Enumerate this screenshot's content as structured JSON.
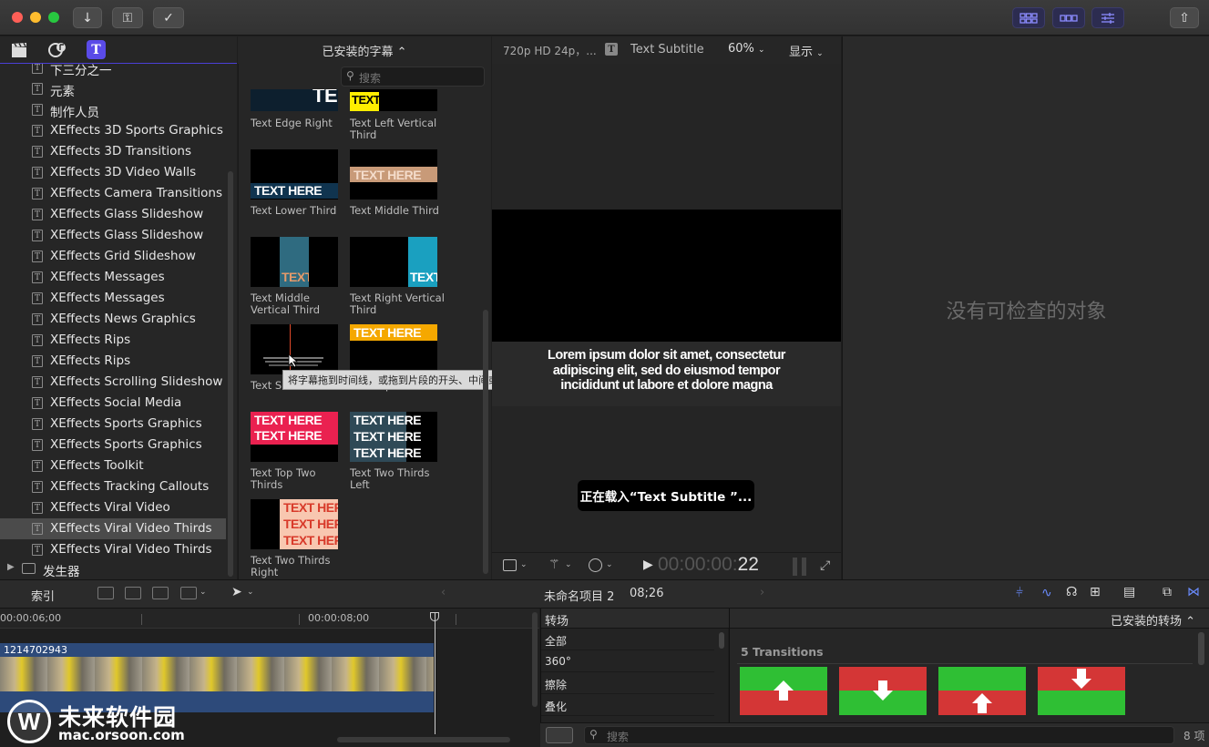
{
  "window": {
    "colors": {
      "accent": "#4b3fd6",
      "selection": "#4b4b4b"
    }
  },
  "toolbar": {
    "icons": [
      "download-icon",
      "key-icon",
      "checkmark-icon",
      "grid-icon",
      "filmstrip-icon",
      "sliders-icon",
      "share-icon"
    ],
    "import_glyph": "↓",
    "key_glyph": "⚿",
    "check_glyph": "✓",
    "share_glyph": "⇧"
  },
  "sidebar": {
    "items": [
      {
        "label": "下三分之一"
      },
      {
        "label": "元素"
      },
      {
        "label": "制作人员"
      },
      {
        "label": "XEffects 3D Sports Graphics"
      },
      {
        "label": "XEffects 3D Transitions"
      },
      {
        "label": "XEffects 3D Video Walls"
      },
      {
        "label": "XEffects Camera Transitions"
      },
      {
        "label": "XEffects Glass Slideshow"
      },
      {
        "label": "XEffects Glass Slideshow"
      },
      {
        "label": "XEffects Grid Slideshow"
      },
      {
        "label": "XEffects Messages"
      },
      {
        "label": "XEffects Messages"
      },
      {
        "label": "XEffects News Graphics"
      },
      {
        "label": "XEffects Rips"
      },
      {
        "label": "XEffects Rips"
      },
      {
        "label": "XEffects Scrolling Slideshow"
      },
      {
        "label": "XEffects Social Media"
      },
      {
        "label": "XEffects Sports Graphics"
      },
      {
        "label": "XEffects Sports Graphics"
      },
      {
        "label": "XEffects Toolkit"
      },
      {
        "label": "XEffects Tracking Callouts"
      },
      {
        "label": "XEffects Viral Video"
      },
      {
        "label": "XEffects Viral Video Thirds"
      },
      {
        "label": "XEffects Viral Video Thirds"
      }
    ],
    "selected_index": 22,
    "generators_label": "发生器",
    "title_glyph": "T"
  },
  "browser": {
    "header": "已安装的字幕 ⌃",
    "search_placeholder": "搜索",
    "items": [
      {
        "caption": "Text Edge Right",
        "text": "TE"
      },
      {
        "caption": "Text Left Vertical Third",
        "text": "TEXT"
      },
      {
        "caption": "Text Lower Third",
        "text": "TEXT HERE"
      },
      {
        "caption": "Text Middle Third",
        "text": "TEXT HERE"
      },
      {
        "caption": "Text Middle Vertical Third",
        "text": "TEXT"
      },
      {
        "caption": "Text Right Vertical Third",
        "text": "TEXT"
      },
      {
        "caption": "Text Subtitle",
        "text": ""
      },
      {
        "caption": "Text Top Third",
        "text": "TEXT HERE"
      },
      {
        "caption": "Text Top Two Thirds",
        "text": "TEXT HERE"
      },
      {
        "caption": "Text Two Thirds Left",
        "text": "TEXT HERE"
      },
      {
        "caption": "Text Two Thirds Right",
        "text": "TEXT HERE"
      }
    ],
    "tooltip": "将字幕拖到时间线，或拖到片段的开头、中间或结尾"
  },
  "viewer": {
    "format": "720p HD 24p，...",
    "clip_title": "Text Subtitle",
    "zoom": "60%",
    "display_menu": "显示",
    "subtitle_text": "Lorem ipsum dolor sit amet, consectetur adipiscing elit, sed do eiusmod tempor incididunt ut labore et dolore magna",
    "loading": "正在载入“Text Subtitle ”...",
    "timecode_dim": "00:00:00:",
    "timecode_frames": "22"
  },
  "inspector": {
    "empty_text": "没有可检查的对象"
  },
  "timeline_bar": {
    "index_label": "索引",
    "project_name": "未命名项目 2",
    "duration": "08;26"
  },
  "timeline": {
    "ruler": [
      "00:00:06;00",
      "00:00:08;00"
    ],
    "clip_name": "1214702943"
  },
  "transitions": {
    "header": "转场",
    "installed": "已安装的转场 ⌃",
    "categories": [
      "全部",
      "360°",
      "擦除",
      "叠化"
    ],
    "count_label": "5 Transitions",
    "search_placeholder": "搜索",
    "item_count": "8 项",
    "colors": {
      "green": "#2fbf34",
      "red": "#d43636"
    }
  },
  "watermark": {
    "brand": "未来软件园",
    "url": "mac.orsoon.com"
  }
}
